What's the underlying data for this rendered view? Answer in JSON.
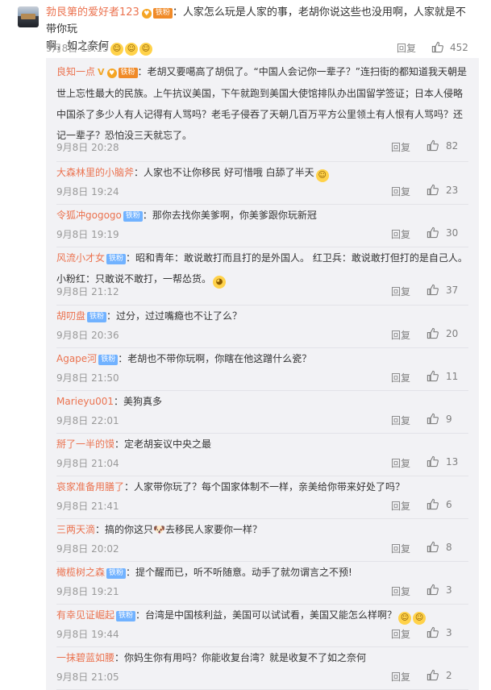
{
  "top": {
    "user": "勃艮第的爱好者123",
    "badge_iron": "铁粉",
    "text_line1": "：人家怎么玩是人家的事，老胡你说这些也没用啊，人家就是不带你玩",
    "text_line2": "啊，如之奈何",
    "time": "9月8日 19:15",
    "reply": "回复",
    "likes": "452"
  },
  "comments": [
    {
      "user": "良知一点",
      "v": "V",
      "badge": "铁粉",
      "text": "：老胡又要噶高了胡侃了。“中国人会记你一辈子？”连扫街的都知道我天朝是世上忘性最大的民族。上午抗议美国，下午就跑到美国大使馆排队办出国留学签证；日本人侵略中国杀了多少人有人记得有人骂吗？老毛子侵吞了天朝几百万平方公里领土有人恨有人骂吗？还记一辈子？恐怕没三天就忘了。",
      "time": "9月8日 20:28",
      "reply": "回复",
      "likes": "82"
    },
    {
      "user": "大森林里的小脑斧",
      "text": "：人家也不让你移民 好可惜哦 白舔了半天",
      "time": "9月8日 19:24",
      "reply": "回复",
      "likes": "23"
    },
    {
      "user": "令狐冲gogogo",
      "badge": "铁粉",
      "text": "：那你去找你美爹啊，你美爹跟你玩新冠",
      "time": "9月8日 19:19",
      "reply": "回复",
      "likes": "30"
    },
    {
      "user": "风流小才女",
      "badge": "铁粉",
      "text": "：昭和青年：敢说敢打而且打的是外国人。 红卫兵：敢说敢打但打的是自己人。 小粉红：只敢说不敢打，一帮怂货。",
      "time": "9月8日 21:12",
      "reply": "回复",
      "likes": "37"
    },
    {
      "user": "胡叨盘",
      "badge": "铁粉",
      "text": "：过分，过过嘴瘾也不让了么？",
      "time": "9月8日 20:36",
      "reply": "回复",
      "likes": "20"
    },
    {
      "user": "Agape河",
      "badge": "铁粉",
      "text": "：老胡也不带你玩啊，你瞎在他这蹭什么瓷？",
      "time": "9月8日 21:50",
      "reply": "回复",
      "likes": "11"
    },
    {
      "user": "Marieyu001",
      "text": "：美狗真多",
      "time": "9月8日 22:01",
      "reply": "回复",
      "likes": "9"
    },
    {
      "user": "掰了一半的馍",
      "text": "：定老胡妄议中央之最",
      "time": "9月8日 21:04",
      "reply": "回复",
      "likes": "13"
    },
    {
      "user": "哀家准备用膳了",
      "text": "：人家带你玩了？每个国家体制不一样，亲美给你带来好处了吗？",
      "time": "9月8日 21:41",
      "reply": "回复",
      "likes": "6"
    },
    {
      "user": "三两天滴",
      "text": "：搞的你这只🐶去移民人家要你一样？",
      "time": "9月8日 20:02",
      "reply": "回复",
      "likes": "8"
    },
    {
      "user": "橄榄树之森",
      "badge": "铁粉",
      "text": "：提个醒而已，听不听随意。动手了就勿谓言之不预!",
      "time": "9月8日 19:21",
      "reply": "回复",
      "likes": "3"
    },
    {
      "user": "有幸见证崛起",
      "badge": "铁粉",
      "text": "：台湾是中国核利益，美国可以试试看，美国又能怎么样啊？",
      "time": "9月8日 19:44",
      "reply": "回复",
      "likes": "3"
    },
    {
      "user": "一抹碧蓝如腰",
      "text": "：你妈生你有用吗？你能收复台湾？就是收复不了如之奈何",
      "time": "9月8日 21:05",
      "reply": "回复",
      "likes": "2"
    }
  ],
  "colors": {
    "username": "#eb7350",
    "meta": "#999999",
    "sub_bg": "#f2f2f5"
  }
}
